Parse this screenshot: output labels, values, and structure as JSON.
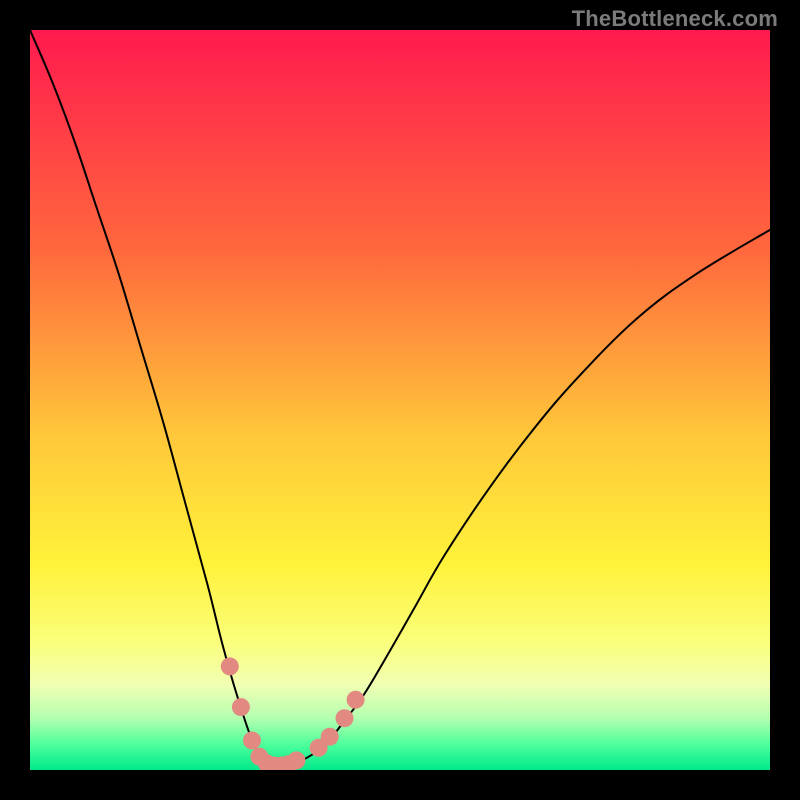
{
  "watermark": {
    "text": "TheBottleneck.com"
  },
  "chart_data": {
    "type": "line",
    "title": "",
    "xlabel": "",
    "ylabel": "",
    "xlim": [
      0,
      100
    ],
    "ylim": [
      0,
      100
    ],
    "grid": false,
    "legend": false,
    "background_gradient": {
      "stops": [
        {
          "offset": 0.0,
          "color": "#ff1a4f"
        },
        {
          "offset": 0.3,
          "color": "#ff693d"
        },
        {
          "offset": 0.55,
          "color": "#ffc83a"
        },
        {
          "offset": 0.72,
          "color": "#fff23a"
        },
        {
          "offset": 0.83,
          "color": "#faff7d"
        },
        {
          "offset": 0.885,
          "color": "#f1ffb3"
        },
        {
          "offset": 0.93,
          "color": "#b4ffb0"
        },
        {
          "offset": 0.965,
          "color": "#4fff9c"
        },
        {
          "offset": 1.0,
          "color": "#00e98b"
        }
      ]
    },
    "series": [
      {
        "name": "bottleneck-curve",
        "color": "#000000",
        "stroke_width": 2,
        "x": [
          0,
          3,
          6,
          9,
          12,
          15,
          18,
          21,
          24,
          26,
          28,
          30,
          31,
          32,
          33,
          34,
          36,
          38,
          40,
          42,
          45,
          48,
          52,
          56,
          62,
          68,
          74,
          82,
          90,
          100
        ],
        "y": [
          100,
          93,
          85,
          76,
          67,
          57,
          47,
          36,
          25,
          17,
          10,
          4,
          2,
          1,
          0.6,
          0.6,
          1,
          2,
          3.5,
          6,
          10,
          15,
          22,
          29,
          38,
          46,
          53,
          61,
          67,
          73
        ]
      }
    ],
    "markers": {
      "name": "highlight-dots",
      "color": "#e28a81",
      "radius": 9,
      "points": [
        {
          "x": 27.0,
          "y": 14.0
        },
        {
          "x": 28.5,
          "y": 8.5
        },
        {
          "x": 30.0,
          "y": 4.0
        },
        {
          "x": 31.0,
          "y": 1.8
        },
        {
          "x": 32.0,
          "y": 0.9
        },
        {
          "x": 33.0,
          "y": 0.6
        },
        {
          "x": 34.0,
          "y": 0.6
        },
        {
          "x": 35.0,
          "y": 0.8
        },
        {
          "x": 36.0,
          "y": 1.3
        },
        {
          "x": 39.0,
          "y": 3.0
        },
        {
          "x": 40.5,
          "y": 4.5
        },
        {
          "x": 42.5,
          "y": 7.0
        },
        {
          "x": 44.0,
          "y": 9.5
        }
      ]
    }
  }
}
